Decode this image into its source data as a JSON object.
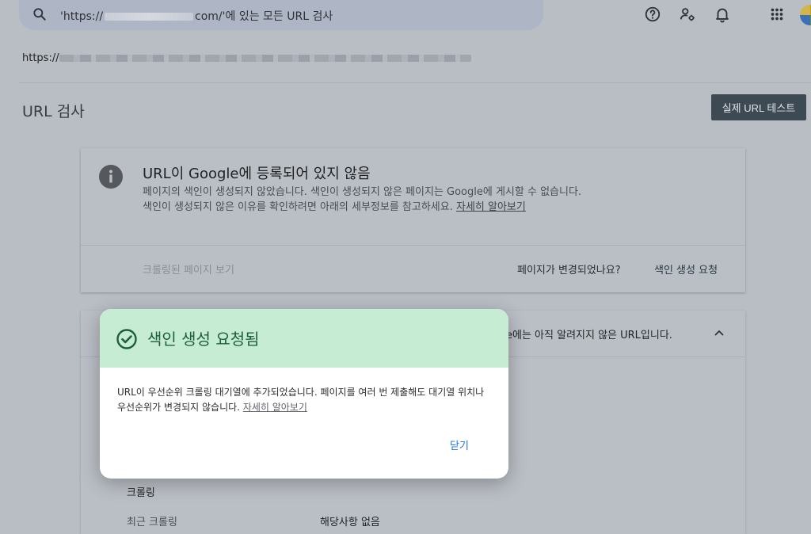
{
  "search": {
    "text_prefix": "'https://",
    "text_suffix": "com/'에 있는 모든 URL 검사"
  },
  "header": {
    "icons": [
      "help-icon",
      "account-settings-icon",
      "notifications-icon",
      "apps-grid-icon",
      "avatar"
    ]
  },
  "url_line": {
    "prefix": "https://"
  },
  "page": {
    "title": "URL 검사",
    "live_test_button": "실제 URL 테스트"
  },
  "status_card": {
    "title": "URL이 Google에 등록되어 있지 않음",
    "desc": "페이지의 색인이 생성되지 않았습니다. 색인이 생성되지 않은 페이지는 Google에 게시할 수 없습니다. 색인이 생성되지 않은 이유를 확인하려면 아래의 세부정보를 참고하세요.",
    "learn_more": "자세히 알아보기",
    "crawled_page_link": "크롤링된 페이지 보기",
    "changed_question": "페이지가 변경되었나요?",
    "request_indexing": "색인 생성 요청"
  },
  "detail_card": {
    "heading_partial": "e에는 아직 알려지지 않은 URL입니다.",
    "crawl_section": "크롤링",
    "recent_crawl_label": "최근 크롤링",
    "recent_crawl_value": "해당사항 없음"
  },
  "dialog": {
    "title": "색인 생성 요청됨",
    "body": "URL이 우선순위 크롤링 대기열에 추가되었습니다. 페이지를 여러 번 제출해도 대기열 위치나 우선순위가 변경되지 않습니다.",
    "learn_more": "자세히 알아보기",
    "close_button": "닫기",
    "accent_color": "#c6edd4",
    "title_color": "#1f5e3a"
  }
}
